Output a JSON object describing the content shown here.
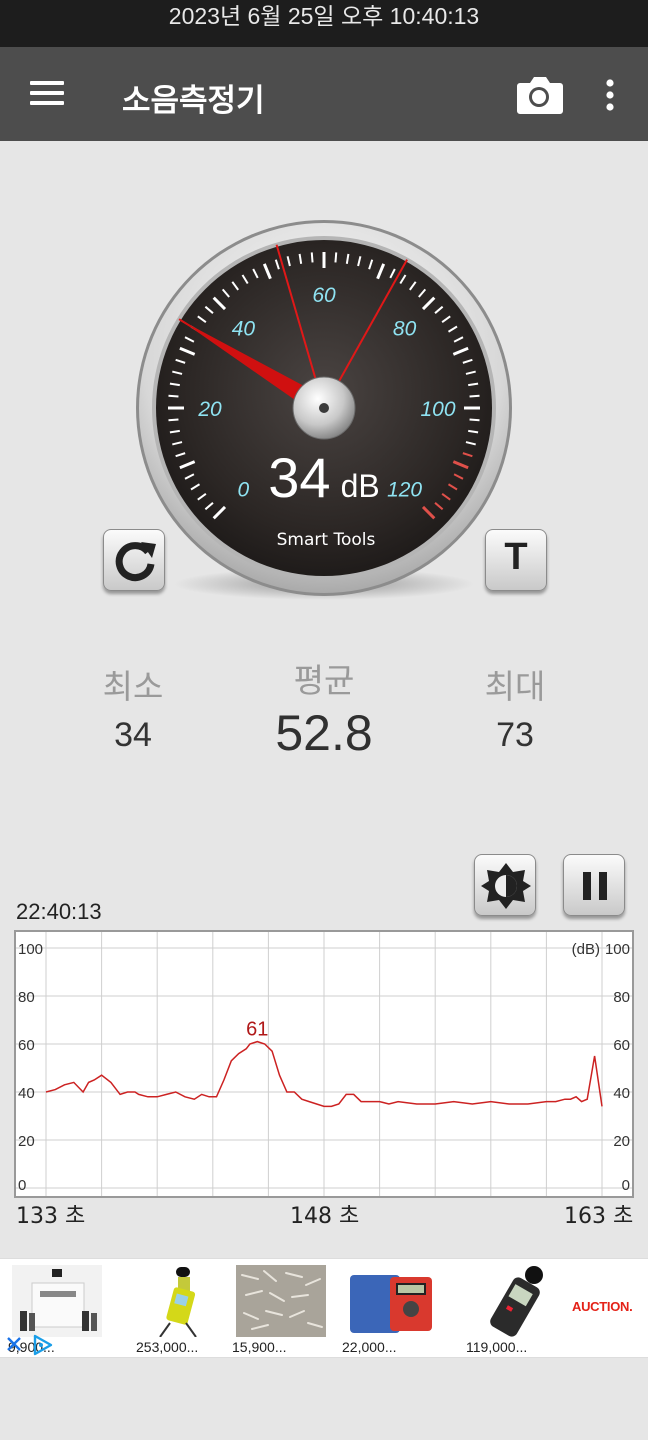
{
  "status_bar": {
    "datetime": "2023년 6월 25일 오후 10:40:13"
  },
  "app_bar": {
    "title": "소음측정기",
    "icons": [
      "menu-icon",
      "camera-icon",
      "more-vert-icon"
    ]
  },
  "gauge": {
    "reading_value": "34",
    "reading_unit": "dB",
    "brand": "Smart Tools",
    "scale_labels": [
      "0",
      "20",
      "40",
      "60",
      "80",
      "100",
      "120"
    ],
    "needle_value": 34,
    "min_marker": 34,
    "avg_marker": 52.8,
    "max_marker": 73,
    "colors": {
      "face": "#2b2624",
      "scale_text": "#8fe3f2",
      "needle": "#d01010"
    }
  },
  "buttons": {
    "reset_icon": "refresh-icon",
    "t_label": "T",
    "brightness_icon": "brightness-icon",
    "pause_icon": "pause-icon"
  },
  "stats": {
    "min_label": "최소",
    "min_value": "34",
    "avg_label": "평균",
    "avg_value": "52.8",
    "max_label": "최대",
    "max_value": "73"
  },
  "graph": {
    "time": "22:40:13",
    "unit_label": "(dB)",
    "peak_label": "61",
    "x_start": "133 초",
    "x_mid": "148 초",
    "x_end": "163 초"
  },
  "chart_data": {
    "type": "line",
    "xlim": [
      133,
      163
    ],
    "ylim": [
      0,
      100
    ],
    "y_ticks": [
      0,
      20,
      40,
      60,
      80,
      100
    ],
    "grid": true,
    "series": [
      {
        "color": "#cc2222",
        "x": [
          133,
          133.5,
          134,
          134.5,
          135,
          135.3,
          135.6,
          136,
          136.5,
          137,
          137.4,
          137.8,
          138,
          138.5,
          139,
          139.5,
          140,
          140.5,
          141,
          141.4,
          141.8,
          142.2,
          142.6,
          143,
          143.4,
          143.8,
          144,
          144.4,
          144.8,
          145.2,
          145.6,
          146,
          146.4,
          146.8,
          147.2,
          147.6,
          148,
          148.4,
          148.8,
          149.2,
          149.6,
          150,
          150.5,
          151,
          151.5,
          152,
          153,
          154,
          155,
          156,
          157,
          158,
          159,
          160,
          160.5,
          161,
          161.3,
          161.6,
          161.9,
          162.2,
          162.6,
          163
        ],
        "y": [
          40,
          41,
          43,
          44,
          40,
          44,
          45,
          47,
          44,
          39,
          40,
          40,
          39,
          38,
          38,
          39,
          40,
          38,
          37,
          39,
          38,
          38,
          45,
          53,
          56,
          58,
          60,
          61,
          60,
          57,
          47,
          40,
          40,
          37,
          36,
          35,
          34,
          34,
          35,
          39,
          39,
          36,
          36,
          36,
          35,
          36,
          35,
          35,
          36,
          35,
          36,
          35,
          35,
          36,
          36,
          37,
          37,
          38,
          36,
          37,
          55,
          34
        ]
      }
    ],
    "annotations": [
      {
        "x": 144.4,
        "y": 61,
        "text": "61"
      }
    ]
  },
  "ads": [
    {
      "price": "9,900...",
      "thumb": "fragrance-set-image"
    },
    {
      "price": "253,000...",
      "thumb": "sound-meter-image"
    },
    {
      "price": "15,900...",
      "thumb": "dried-anchovy-image"
    },
    {
      "price": "22,000...",
      "thumb": "multimeter-case-image"
    },
    {
      "price": "119,000...",
      "thumb": "handheld-meter-image"
    }
  ],
  "ad_brand": "AUCTION."
}
